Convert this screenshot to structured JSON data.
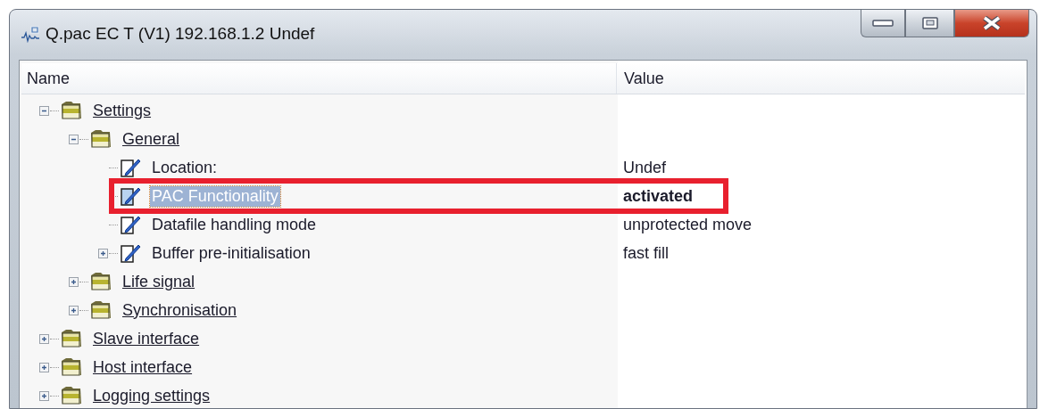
{
  "window": {
    "title": "Q.pac EC T (V1) 192.168.1.2 Undef"
  },
  "columns": [
    "Name",
    "Value"
  ],
  "tree": [
    {
      "kind": "folder",
      "label": "Settings",
      "expanded": true,
      "children": [
        {
          "kind": "folder",
          "label": "General",
          "expanded": true,
          "children": [
            {
              "kind": "parameter",
              "label": "Location:",
              "value": "Undef",
              "selected": false,
              "highlighted": false
            },
            {
              "kind": "parameter",
              "label": "PAC Functionality",
              "value": "activated",
              "selected": true,
              "highlighted": true
            },
            {
              "kind": "parameter",
              "label": "Datafile handling mode",
              "value": "unprotected move",
              "selected": false,
              "highlighted": false
            },
            {
              "kind": "parameter",
              "label": "Buffer pre-initialisation",
              "value": "fast fill",
              "selected": false,
              "highlighted": false,
              "expanded": false
            }
          ]
        },
        {
          "kind": "folder",
          "label": "Life signal",
          "expanded": false
        },
        {
          "kind": "folder",
          "label": "Synchronisation",
          "expanded": false
        }
      ]
    },
    {
      "kind": "folder",
      "label": "Slave interface",
      "expanded": false
    },
    {
      "kind": "folder",
      "label": "Host interface",
      "expanded": false
    },
    {
      "kind": "folder",
      "label": "Logging settings",
      "expanded": false
    }
  ]
}
